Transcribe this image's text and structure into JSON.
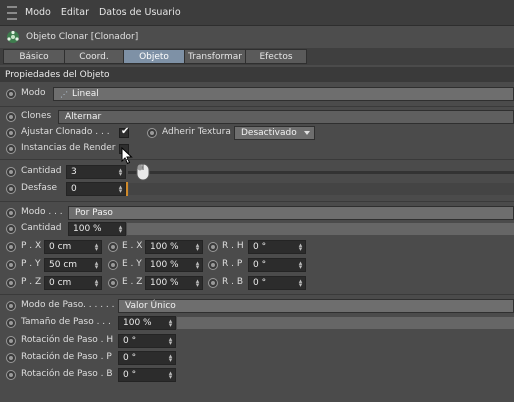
{
  "menubar": {
    "items": [
      "Modo",
      "Editar",
      "Datos de Usuario"
    ]
  },
  "object": {
    "title": "Objeto Clonar [Clonador]",
    "icon": "cloner-icon"
  },
  "tabs": [
    {
      "label": "Básico",
      "active": false
    },
    {
      "label": "Coord.",
      "active": false
    },
    {
      "label": "Objeto",
      "active": true
    },
    {
      "label": "Transformar",
      "active": false
    },
    {
      "label": "Efectos",
      "active": false
    }
  ],
  "section": {
    "title": "Propiedades del Objeto"
  },
  "fields": {
    "modo": {
      "label": "Modo",
      "value": "Lineal"
    },
    "clones": {
      "label": "Clones",
      "value": "Alternar"
    },
    "ajustar": {
      "label": "Ajustar Clonado . . .",
      "checked": true
    },
    "adherir": {
      "label": "Adherir Textura",
      "value": "Desactivado"
    },
    "instancias": {
      "label": "Instancias de Render",
      "checked": false
    },
    "cantidad": {
      "label": "Cantidad",
      "value": "3"
    },
    "desfase": {
      "label": "Desfase",
      "value": "0"
    },
    "modo2": {
      "label": "Modo . . .",
      "value": "Por Paso"
    },
    "cantidad2": {
      "label": "Cantidad",
      "value": "100 %"
    },
    "px": {
      "label": "P . X",
      "value": "0 cm"
    },
    "py": {
      "label": "P . Y",
      "value": "50 cm"
    },
    "pz": {
      "label": "P . Z",
      "value": "0 cm"
    },
    "ex": {
      "label": "E . X",
      "value": "100 %"
    },
    "ey": {
      "label": "E . Y",
      "value": "100 %"
    },
    "ez": {
      "label": "E . Z",
      "value": "100 %"
    },
    "rh": {
      "label": "R . H",
      "value": "0 °"
    },
    "rp": {
      "label": "R . P",
      "value": "0 °"
    },
    "rb": {
      "label": "R . B",
      "value": "0 °"
    },
    "modo_paso": {
      "label": "Modo de Paso. . . . . .",
      "value": "Valor Único"
    },
    "tamano_paso": {
      "label": "Tamaño de Paso . . .",
      "value": "100 %"
    },
    "rot_h": {
      "label": "Rotación de Paso . H",
      "value": "0 °"
    },
    "rot_p": {
      "label": "Rotación de Paso . P",
      "value": "0 °"
    },
    "rot_b": {
      "label": "Rotación de Paso . B",
      "value": "0 °"
    }
  },
  "colors": {
    "background": "#4b4b4b",
    "menubar": "#3d3d3d",
    "tab_active": "#7e91a6",
    "field_dark": "#2c2c2c",
    "dropdown": "#6e6e6e",
    "accent_orange": "#d08a2a"
  }
}
